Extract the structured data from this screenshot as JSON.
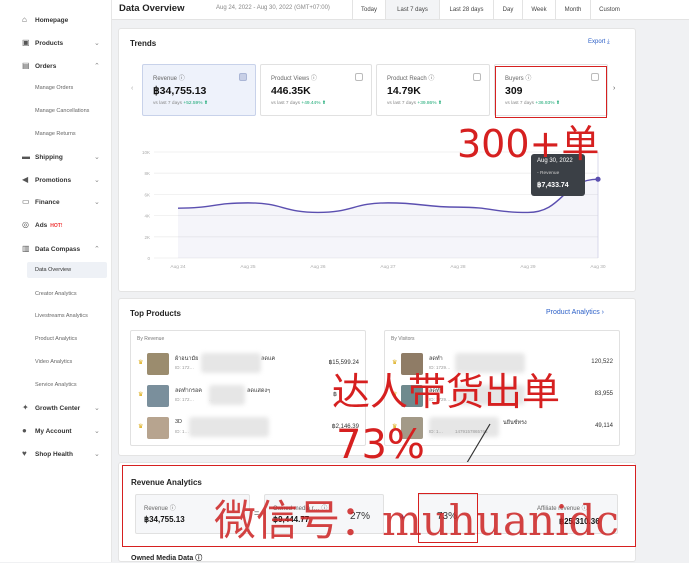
{
  "sidebar": {
    "items": [
      {
        "label": "Homepage",
        "icon": "home-icon",
        "chevron": ""
      },
      {
        "label": "Products",
        "icon": "box-icon",
        "chevron": "⌄"
      },
      {
        "label": "Orders",
        "icon": "orders-icon",
        "chevron": "⌃"
      },
      {
        "label": "Shipping",
        "icon": "truck-icon",
        "chevron": "⌄"
      },
      {
        "label": "Promotions",
        "icon": "megaphone-icon",
        "chevron": "⌄"
      },
      {
        "label": "Finance",
        "icon": "wallet-icon",
        "chevron": "⌄"
      },
      {
        "label": "Ads",
        "icon": "ads-icon",
        "chevron": "",
        "badge": "HOT!"
      },
      {
        "label": "Data Compass",
        "icon": "chart-icon",
        "chevron": "⌃"
      },
      {
        "label": "Growth Center",
        "icon": "growth-icon",
        "chevron": "⌄"
      },
      {
        "label": "My Account",
        "icon": "user-icon",
        "chevron": "⌄"
      },
      {
        "label": "Shop Health",
        "icon": "health-icon",
        "chevron": "⌄"
      }
    ],
    "orders_sub": [
      "Manage Orders",
      "Manage Cancellations",
      "Manage Returns"
    ],
    "compass_sub": [
      "Data Overview",
      "Creator Analytics",
      "Livestreams Analytics",
      "Product Analytics",
      "Video Analytics",
      "Service Analytics"
    ]
  },
  "header": {
    "title": "Data Overview",
    "date_range": "Aug 24, 2022 - Aug 30, 2022 (GMT+07:00)",
    "buttons": [
      "Today",
      "Last 7 days",
      "Last 28 days",
      "Day",
      "Week",
      "Month",
      "Custom"
    ]
  },
  "trends": {
    "title": "Trends",
    "export": "Export",
    "metrics": [
      {
        "name": "Revenue",
        "value": "฿34,755.13",
        "cmp_prefix": "vs last 7 days",
        "cmp": "+52.59%"
      },
      {
        "name": "Product Views",
        "value": "446.35K",
        "cmp_prefix": "vs last 7 days",
        "cmp": "+49.44%"
      },
      {
        "name": "Product Reach",
        "value": "14.79K",
        "cmp_prefix": "vs last 7 days",
        "cmp": "+39.86%"
      },
      {
        "name": "Buyers",
        "value": "309",
        "cmp_prefix": "vs last 7 days",
        "cmp": "+36.93%"
      }
    ],
    "tooltip": {
      "date": "Aug 30, 2022",
      "series": "Revenue",
      "value": "฿7,433.74"
    }
  },
  "chart_data": {
    "type": "area",
    "x": [
      "Aug 24",
      "Aug 25",
      "Aug 26",
      "Aug 27",
      "Aug 28",
      "Aug 29",
      "Aug 30"
    ],
    "series": [
      {
        "name": "Revenue",
        "values": [
          4700,
          5200,
          4300,
          5200,
          4800,
          4300,
          7433.74
        ]
      }
    ],
    "y_ticks": [
      "10K",
      "8K",
      "6K",
      "4K",
      "2K",
      "0"
    ],
    "ylim": [
      0,
      10000
    ],
    "grid": true,
    "line_color": "#5b4fb0"
  },
  "top_products": {
    "title": "Top Products",
    "link": "Product Analytics",
    "by_revenue": {
      "label": "By Revenue",
      "rows": [
        {
          "name": "ผ้าอนามัย",
          "name2": "ลดแค",
          "id": "ID: 172…",
          "id2": "…369",
          "value": "฿15,599.24",
          "thumb": "#9b8c6e"
        },
        {
          "name": "ลดทำกรอค",
          "name2": "ลดแสดงๆ",
          "id": "ID: 172…",
          "id2": "…04905325",
          "value": "฿",
          "thumb": "#7a8f9c"
        },
        {
          "name": "3D",
          "name2": "",
          "id": "ID: 1…",
          "id2": "1479457865765",
          "value": "฿2,146.39",
          "thumb": "#b7a48f"
        }
      ]
    },
    "by_visitors": {
      "label": "By Visitors",
      "rows": [
        {
          "name": "ลดทำ",
          "name2": "",
          "id": "ID: 1729…",
          "id2": "",
          "value": "120,522",
          "thumb": "#8f7c66"
        },
        {
          "name": "ลดทำ",
          "name2": "",
          "id": "ID: 1729…",
          "id2": "",
          "value": "83,955",
          "thumb": "#6f8a8e"
        },
        {
          "name": "",
          "name2": "นยีนซ์ทรง",
          "id": "ID: 1…",
          "id2": "1479157865765",
          "value": "49,114",
          "thumb": "#a39a88"
        }
      ]
    }
  },
  "revenue_analytics": {
    "title": "Revenue Analytics",
    "revenue_label": "Revenue",
    "revenue_value": "฿34,755.13",
    "equals": "=",
    "owned_label": "Owned media r…",
    "owned_value": "฿9,444.77",
    "owned_pct": "27%",
    "plus": "+",
    "affiliate_pct": "73%",
    "affiliate_label": "Affiliate revenue",
    "affiliate_value": "฿25,310.36"
  },
  "owned_media_data": "Owned Media Data",
  "annotations": {
    "buyers_note": "300+单",
    "affiliate_note_line1": "达人带货出单",
    "affiliate_note_line2": "73%",
    "watermark": "微信号：muhuanidc"
  }
}
